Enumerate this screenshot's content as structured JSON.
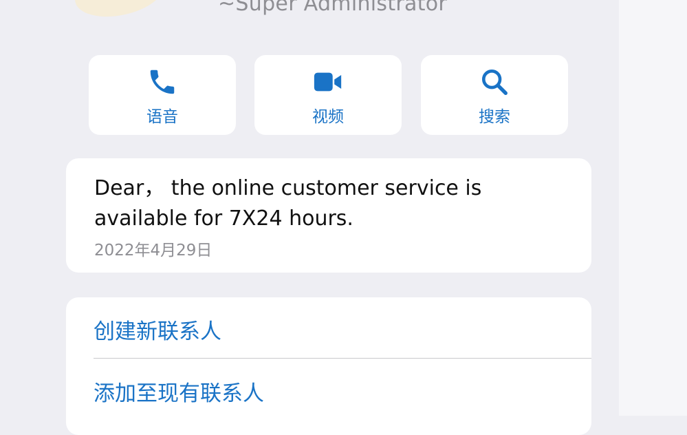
{
  "header": {
    "subtitle": "~Super Administrator"
  },
  "actions": [
    {
      "label": "语音",
      "icon": "phone-icon"
    },
    {
      "label": "视频",
      "icon": "video-icon"
    },
    {
      "label": "搜索",
      "icon": "search-icon"
    }
  ],
  "message": {
    "text": "Dear， the online customer service is available for 7X24 hours.",
    "date": "2022年4月29日"
  },
  "contact_options": [
    {
      "label": "创建新联系人"
    },
    {
      "label": "添加至现有联系人"
    }
  ],
  "colors": {
    "background": "#eeeef3",
    "card": "#ffffff",
    "accent": "#1a73c6",
    "secondary_text": "#8e8e93",
    "primary_text": "#111111"
  }
}
